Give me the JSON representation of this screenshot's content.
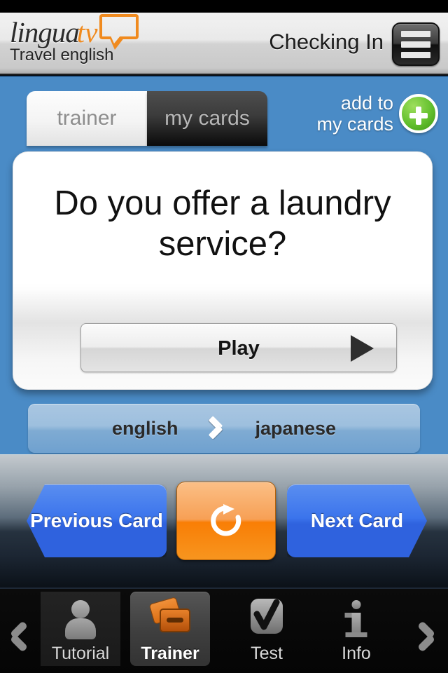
{
  "app": {
    "logo_main": "lingua",
    "logo_accent": "tv",
    "subtitle": "Travel english",
    "header_title": "Checking In",
    "menu_icon": "hamburger-menu-icon"
  },
  "tabs": {
    "items": [
      {
        "label": "trainer",
        "state": "active"
      },
      {
        "label": "my cards",
        "state": "inactive"
      }
    ]
  },
  "add_to_cards": {
    "line1": "add to",
    "line2": "my cards",
    "icon": "plus-circle-icon"
  },
  "card": {
    "question": "Do you offer a laundry service?",
    "play_label": "Play",
    "play_icon": "play-triangle-icon"
  },
  "language_bar": {
    "source": "english",
    "separator_icon": "chevron-right-icon",
    "target": "japanese"
  },
  "controls": {
    "previous_label": "Previous Card",
    "next_label": "Next Card",
    "refresh_icon": "refresh-circular-arrow-icon"
  },
  "tabbar": {
    "prev_icon": "chevron-left-icon",
    "next_icon": "chevron-right-icon",
    "items": [
      {
        "label": "Tutorial",
        "icon": "person-icon",
        "state": "inactive"
      },
      {
        "label": "Trainer",
        "icon": "cards-icon",
        "state": "active"
      },
      {
        "label": "Test",
        "icon": "checkmark-icon",
        "state": "inactive"
      },
      {
        "label": "Info",
        "icon": "info-icon",
        "state": "inactive"
      }
    ]
  },
  "colors": {
    "brand_orange": "#f08a1e",
    "body_blue": "#4a8bc6",
    "button_blue": "#2f62de",
    "accent_green": "#63c02e"
  }
}
